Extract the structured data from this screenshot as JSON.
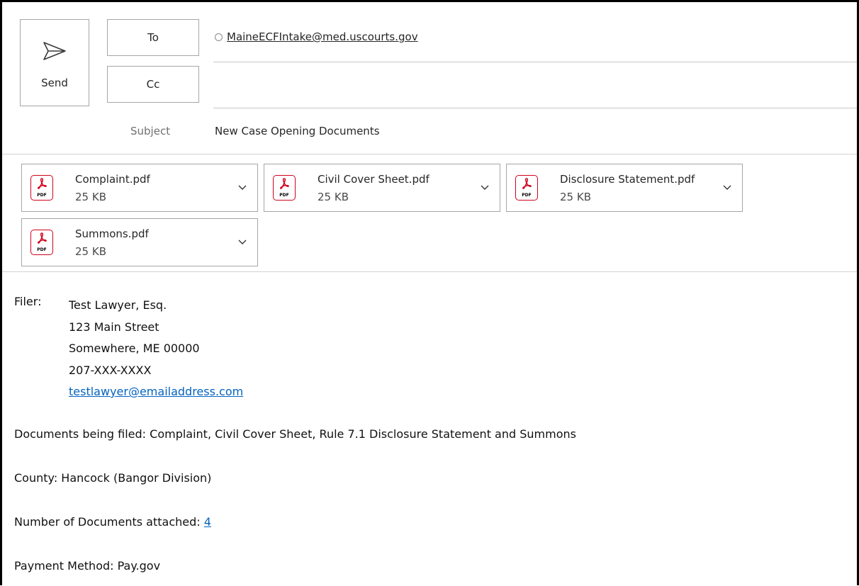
{
  "header": {
    "send_label": "Send",
    "to_label": "To",
    "cc_label": "Cc",
    "to_recipient": "MaineECFIntake@med.uscourts.gov",
    "cc_value": "",
    "subject_label": "Subject",
    "subject_value": "New Case Opening Documents"
  },
  "attachments": [
    {
      "name": "Complaint.pdf",
      "size": "25 KB",
      "icon_text": "PDF"
    },
    {
      "name": "Civil Cover Sheet.pdf",
      "size": "25 KB",
      "icon_text": "PDF"
    },
    {
      "name": "Disclosure Statement.pdf",
      "size": "25 KB",
      "icon_text": "PDF"
    },
    {
      "name": "Summons.pdf",
      "size": "25 KB",
      "icon_text": "PDF"
    }
  ],
  "body": {
    "filer_label": "Filer:",
    "filer_name": "Test Lawyer, Esq.",
    "filer_street": "123 Main Street",
    "filer_city": "Somewhere, ME 00000",
    "filer_phone": "207-XXX-XXXX",
    "filer_email": "testlawyer@emailaddress.com",
    "documents_line": "Documents being filed: Complaint, Civil Cover Sheet, Rule 7.1 Disclosure Statement and Summons",
    "county_line": "County: Hancock (Bangor Division)",
    "num_docs_prefix": "Number of Documents attached: ",
    "num_docs_value": "4",
    "payment_line": "Payment Method: Pay.gov"
  },
  "colors": {
    "pdf_red": "#d0021b",
    "link_blue": "#0563c1",
    "border_gray": "#a6a6a6"
  },
  "icons": {
    "send": "send-icon",
    "pdf": "pdf-icon",
    "chevron": "chevron-down-icon",
    "presence": "presence-status-icon"
  }
}
